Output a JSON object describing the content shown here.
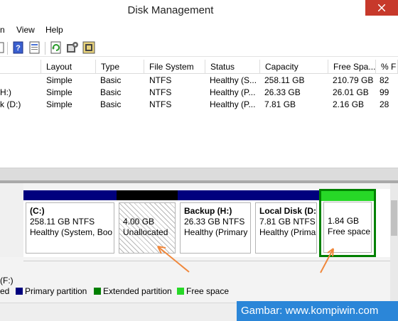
{
  "window": {
    "title": "Disk Management",
    "close_glyph": "✕"
  },
  "menu": {
    "items": [
      "n",
      "View",
      "Help"
    ]
  },
  "volume_list": {
    "columns": [
      "Layout",
      "Type",
      "File System",
      "Status",
      "Capacity",
      "Free Spa...",
      "% F"
    ],
    "rows": [
      {
        "name": "",
        "layout": "Simple",
        "type": "Basic",
        "fs": "NTFS",
        "status": "Healthy (S...",
        "capacity": "258.11 GB",
        "free": "210.79 GB",
        "pct": "82"
      },
      {
        "name": "H:)",
        "layout": "Simple",
        "type": "Basic",
        "fs": "NTFS",
        "status": "Healthy (P...",
        "capacity": "26.33 GB",
        "free": "26.01 GB",
        "pct": "99"
      },
      {
        "name": "k (D:)",
        "layout": "Simple",
        "type": "Basic",
        "fs": "NTFS",
        "status": "Healthy (P...",
        "capacity": "7.81 GB",
        "free": "2.16 GB",
        "pct": "28"
      }
    ]
  },
  "partitions": [
    {
      "label": "(C:)",
      "size": "258.11 GB NTFS",
      "status": "Healthy (System, Boo",
      "bar_color": "#00007e"
    },
    {
      "label": "",
      "size": "4.00 GB",
      "status": "Unallocated",
      "bar_color": "#000000"
    },
    {
      "label": "Backup  (H:)",
      "size": "26.33 GB NTFS",
      "status": "Healthy (Primary",
      "bar_color": "#00007e"
    },
    {
      "label": "Local Disk  (D:",
      "size": "7.81 GB NTFS",
      "status": "Healthy (Prima",
      "bar_color": "#00007e"
    },
    {
      "label": "",
      "size": "1.84 GB",
      "status": "Free space",
      "bar_color": "#27d827"
    }
  ],
  "second_disk_label": "(F:)",
  "legend": [
    {
      "label": "ed",
      "color": "#000000"
    },
    {
      "label": "Primary partition",
      "color": "#00007e"
    },
    {
      "label": "Extended partition",
      "color": "#008000"
    },
    {
      "label": "Free space",
      "color": "#27d827"
    }
  ],
  "watermark": "Gambar: www.kompiwin.com",
  "colors": {
    "arrow": "#f0883c",
    "extended_border": "#008000",
    "close": "#c7392b"
  },
  "icons": [
    "toolbar-icon",
    "help-book-icon",
    "properties-icon",
    "refresh-icon",
    "settings-icon",
    "wizard-icon"
  ]
}
